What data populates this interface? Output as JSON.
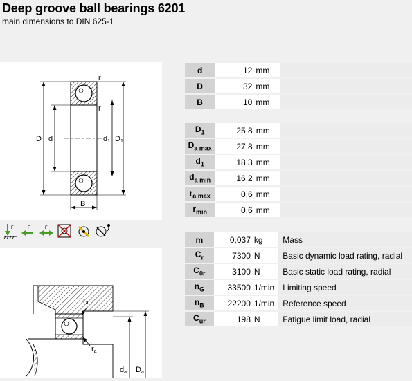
{
  "page": {
    "title": "Deep groove ball bearings 6201",
    "subtitle": "main dimensions to DIN 625-1"
  },
  "drawing1": {
    "labels": {
      "r_top": "r",
      "r_mid": "r",
      "D": "D",
      "d": "d",
      "d1": "d",
      "d1_sub": "1",
      "D1": "D",
      "D1_sub": "1",
      "B": "B"
    }
  },
  "drawing2": {
    "labels": {
      "ra_top": "r",
      "ra_top_sub": "a",
      "ra_bot": "r",
      "ra_bot_sub": "a",
      "da": "d",
      "da_sub": "a",
      "Da": "D",
      "Da_sub": "a"
    }
  },
  "load_icons": [
    "radial-load-icon",
    "axial-load-icon",
    "bidirectional-axial-load-icon",
    "misalignment-icon",
    "high-speed-icon",
    "low-noise-icon"
  ],
  "table1": [
    {
      "sym": "d",
      "sub": "",
      "value": "12",
      "unit": "mm"
    },
    {
      "sym": "D",
      "sub": "",
      "value": "32",
      "unit": "mm"
    },
    {
      "sym": "B",
      "sub": "",
      "value": "10",
      "unit": "mm"
    }
  ],
  "table2": [
    {
      "sym": "D",
      "sub": "1",
      "value": "25,8",
      "unit": "mm"
    },
    {
      "sym": "D",
      "sub": "a max",
      "value": "27,8",
      "unit": "mm"
    },
    {
      "sym": "d",
      "sub": "1",
      "value": "18,3",
      "unit": "mm"
    },
    {
      "sym": "d",
      "sub": "a min",
      "value": "16,2",
      "unit": "mm"
    },
    {
      "sym": "r",
      "sub": "a max",
      "value": "0,6",
      "unit": "mm"
    },
    {
      "sym": "r",
      "sub": "min",
      "value": "0,6",
      "unit": "mm"
    }
  ],
  "table3": [
    {
      "sym": "m",
      "sub": "",
      "value": "0,037",
      "unit": "kg",
      "desc": "Mass"
    },
    {
      "sym": "C",
      "sub": "r",
      "value": "7300",
      "unit": "N",
      "desc": "Basic dynamic load rating, radial"
    },
    {
      "sym": "C",
      "sub": "0r",
      "value": "3100",
      "unit": "N",
      "desc": "Basic static load rating, radial"
    },
    {
      "sym": "n",
      "sub": "G",
      "value": "33500",
      "unit": "1/min",
      "desc": "Limiting speed"
    },
    {
      "sym": "n",
      "sub": "B",
      "value": "22200",
      "unit": "1/min",
      "desc": "Reference speed"
    },
    {
      "sym": "C",
      "sub": "ur",
      "value": "198",
      "unit": "N",
      "desc": "Fatigue limit load, radial"
    }
  ]
}
